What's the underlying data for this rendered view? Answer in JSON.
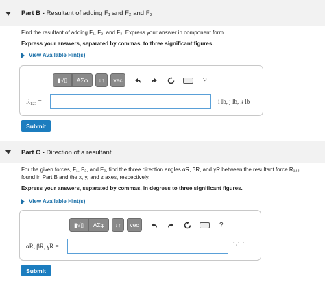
{
  "part_b": {
    "header_prefix": "Part B - ",
    "header_title": "Resultant of adding F₁ and F₂ and F₃",
    "prompt": "Find the resultant of adding F₁, F₂, and F₃. Express your answer in component form.",
    "instruction": "Express your answers, separated by commas, to three significant figures.",
    "hint_label": "View Available Hint(s)",
    "toolbar": {
      "templates_label": "▮√▯",
      "symbols_label": "ΑΣφ",
      "arrows_label": "↓↑",
      "vec_label": "vec",
      "undo_icon": "undo-icon",
      "redo_icon": "redo-icon",
      "reset_icon": "reset-icon",
      "keyboard_icon": "keyboard-icon",
      "help_label": "?"
    },
    "answer_label": "R₁₂₃ =",
    "answer_value": "",
    "units": "i lb, j lb, k lb",
    "submit_label": "Submit"
  },
  "part_c": {
    "header_prefix": "Part C - ",
    "header_title": "Direction of a resultant",
    "prompt_line1": "For the given forces, F₁, F₂, and F₃, find the three direction angles αR, βR, and γR between the resultant force R₁₂₃",
    "prompt_line2": "found in Part B and the x, y, and z axes, respectively.",
    "instruction": "Express your answers, separated by commas, in degrees to three significant figures.",
    "hint_label": "View Available Hint(s)",
    "toolbar": {
      "templates_label": "▮√▯",
      "symbols_label": "ΑΣφ",
      "arrows_label": "↓↑",
      "vec_label": "vec",
      "undo_icon": "undo-icon",
      "redo_icon": "redo-icon",
      "reset_icon": "reset-icon",
      "keyboard_icon": "keyboard-icon",
      "help_label": "?"
    },
    "answer_label": "αR, βR, γR =",
    "answer_value": "",
    "units": "° , ° , °",
    "submit_label": "Submit"
  },
  "colors": {
    "accent": "#1c7dbf",
    "link": "#1a6fa8",
    "toolbar_button": "#8a8a8a",
    "header_bg": "#f2f2f2"
  }
}
